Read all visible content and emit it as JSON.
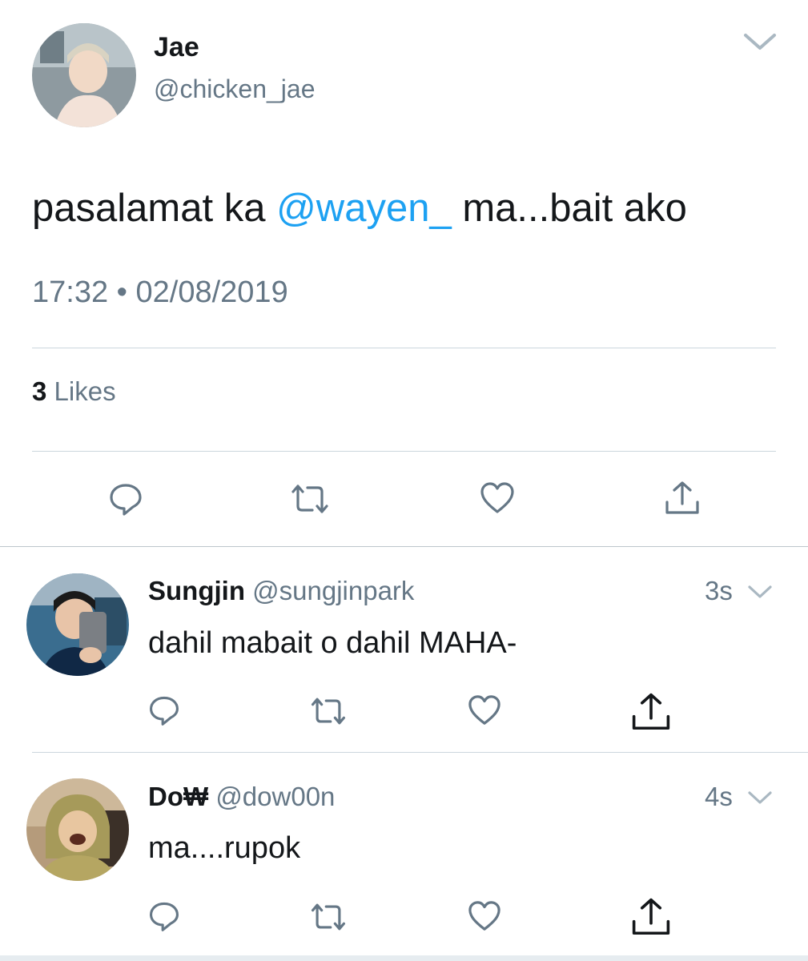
{
  "main_tweet": {
    "name": "Jae",
    "handle": "@chicken_jae",
    "text_before": "pasalamat ka ",
    "mention": "@wayen_",
    "text_after": " ma...bait ako",
    "timestamp": "17:32 • 02/08/2019",
    "likes_count": "3",
    "likes_label": " Likes"
  },
  "replies": [
    {
      "name": "Sungjin",
      "handle": "@sungjinpark",
      "time": "3s",
      "text": "dahil mabait o dahil MAHA-"
    },
    {
      "name": "Do₩",
      "handle": "@dow00n",
      "time": "4s",
      "text": "ma....rupok"
    }
  ],
  "icons": [
    "chevron-down-icon",
    "reply-icon",
    "retweet-icon",
    "like-icon",
    "share-icon"
  ],
  "colors": {
    "text": "#14171a",
    "secondary": "#657786",
    "accent": "#1da1f2",
    "divider": "#ccd6dd",
    "icon": "#657786"
  }
}
